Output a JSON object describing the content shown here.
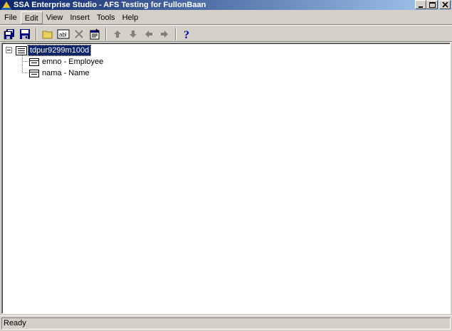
{
  "window": {
    "title": "SSA Enterprise Studio - AFS Testing for FullonBaan",
    "controls": [
      "minimize",
      "maximize",
      "close"
    ]
  },
  "menu": {
    "items": [
      {
        "label": "File"
      },
      {
        "label": "Edit"
      },
      {
        "label": "View"
      },
      {
        "label": "Insert"
      },
      {
        "label": "Tools"
      },
      {
        "label": "Help"
      }
    ]
  },
  "toolbar": {
    "buttons": [
      {
        "icon": "save-all-icon"
      },
      {
        "icon": "save-icon"
      },
      {
        "icon": "open-folder-icon"
      },
      {
        "icon": "text-field-icon"
      },
      {
        "icon": "delete-icon"
      },
      {
        "icon": "properties-icon"
      },
      {
        "icon": "arrow-up-icon"
      },
      {
        "icon": "arrow-down-icon"
      },
      {
        "icon": "arrow-left-icon"
      },
      {
        "icon": "arrow-right-icon"
      },
      {
        "icon": "help-icon"
      }
    ]
  },
  "tree": {
    "root": {
      "label": "tdpur9299m100d",
      "expanded": true,
      "selected": true
    },
    "children": [
      {
        "label": "emno - Employee"
      },
      {
        "label": "nama - Name"
      }
    ]
  },
  "status": {
    "text": "Ready"
  },
  "colors": {
    "title_start": "#0a246a",
    "title_end": "#a6caf0",
    "face": "#d4d0c8",
    "selection": "#0a246a"
  }
}
